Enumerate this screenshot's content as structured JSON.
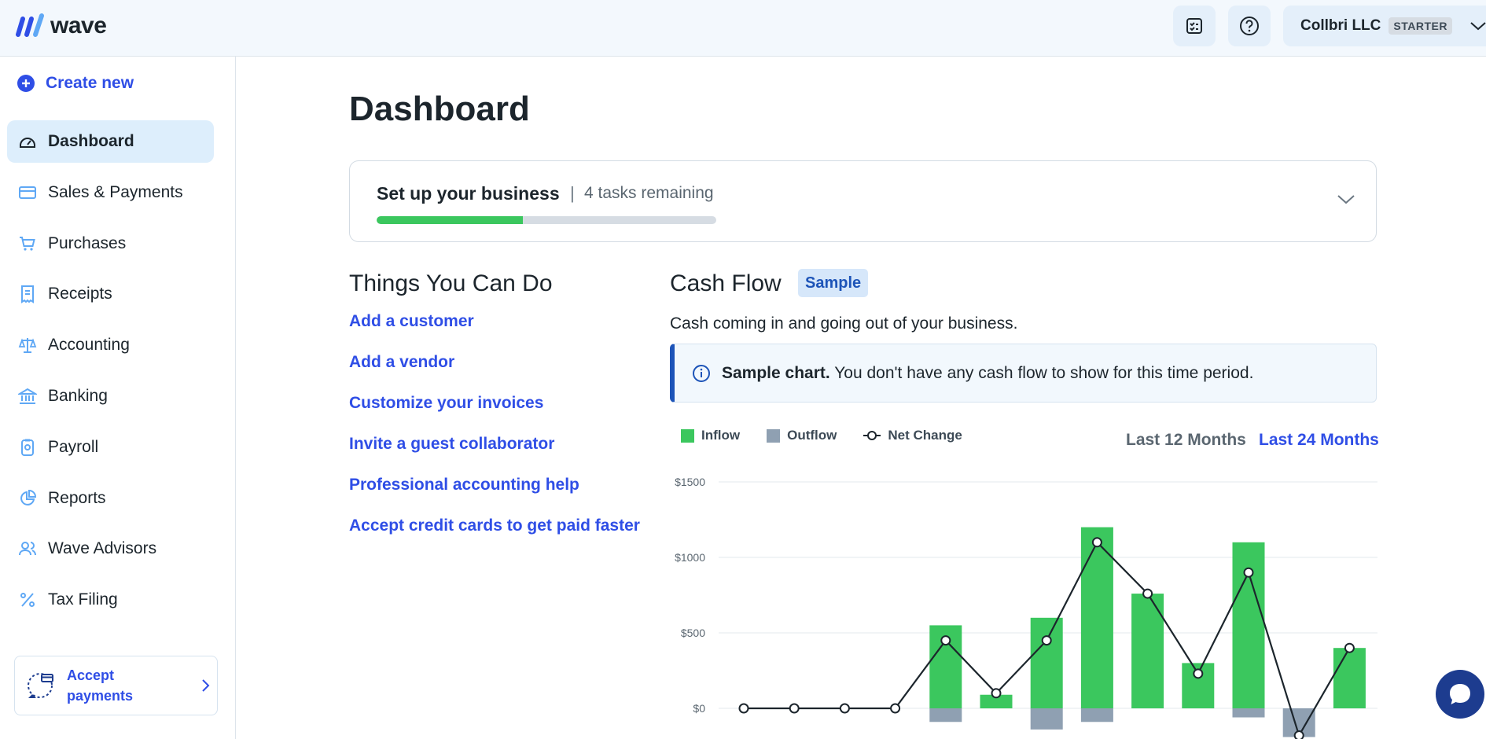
{
  "brand": {
    "name": "wave"
  },
  "header": {
    "account_name": "Collbri LLC",
    "plan_badge": "STARTER"
  },
  "sidebar": {
    "create_new": "Create new",
    "items": [
      {
        "label": "Dashboard",
        "icon": "dashboard-icon",
        "active": true
      },
      {
        "label": "Sales & Payments",
        "icon": "credit-card-icon"
      },
      {
        "label": "Purchases",
        "icon": "cart-icon"
      },
      {
        "label": "Receipts",
        "icon": "receipt-icon"
      },
      {
        "label": "Accounting",
        "icon": "scale-icon"
      },
      {
        "label": "Banking",
        "icon": "bank-icon"
      },
      {
        "label": "Payroll",
        "icon": "payroll-icon"
      },
      {
        "label": "Reports",
        "icon": "pie-chart-icon"
      },
      {
        "label": "Wave Advisors",
        "icon": "advisors-icon"
      },
      {
        "label": "Tax Filing",
        "icon": "percent-icon"
      }
    ],
    "promo": {
      "label": "Accept payments"
    }
  },
  "main": {
    "title": "Dashboard",
    "setup": {
      "title": "Set up your business",
      "separator": "|",
      "remaining": "4 tasks remaining",
      "progress": 0.43
    },
    "things": {
      "title": "Things You Can Do",
      "links": [
        "Add a customer",
        "Add a vendor",
        "Customize your invoices",
        "Invite a guest collaborator",
        "Professional accounting help",
        "Accept credit cards to get paid faster"
      ]
    },
    "cashflow": {
      "title": "Cash Flow",
      "badge": "Sample",
      "description": "Cash coming in and going out of your business.",
      "notice_bold": "Sample chart.",
      "notice_text": "You don't have any cash flow to show for this time period.",
      "range_12": "Last 12 Months",
      "range_24": "Last 24 Months"
    }
  },
  "colors": {
    "accent": "#2f4ee6",
    "inflow": "#3bc75e",
    "outflow": "#8fa0b2",
    "net": "#1c252c"
  },
  "chart_data": {
    "type": "bar",
    "legend": [
      "Inflow",
      "Outflow",
      "Net Change"
    ],
    "yticks": [
      "$1500",
      "$1000",
      "$500",
      "$0"
    ],
    "ylim": [
      -200,
      1500
    ],
    "grid": true,
    "legend_position": "top-left",
    "series": [
      {
        "name": "Inflow",
        "values": [
          0,
          0,
          0,
          0,
          550,
          90,
          600,
          1200,
          760,
          300,
          1100,
          0,
          400
        ]
      },
      {
        "name": "Outflow",
        "values": [
          0,
          0,
          0,
          0,
          -90,
          0,
          -140,
          -90,
          0,
          0,
          -60,
          -190,
          0
        ]
      },
      {
        "name": "Net Change",
        "values": [
          0,
          0,
          0,
          0,
          450,
          100,
          450,
          1100,
          760,
          230,
          900,
          -180,
          400
        ]
      }
    ]
  }
}
